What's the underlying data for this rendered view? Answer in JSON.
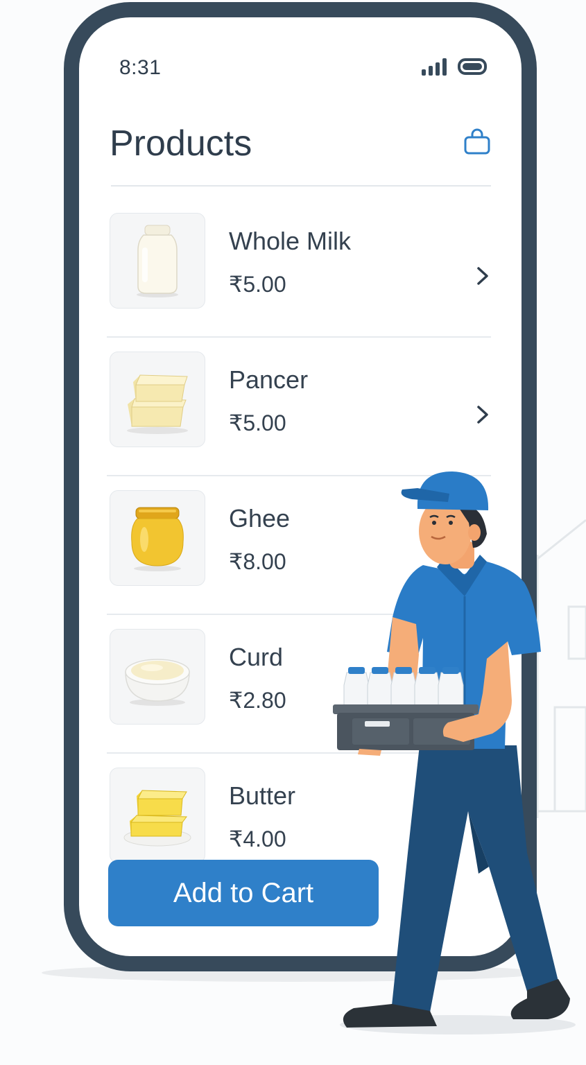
{
  "status_bar": {
    "time": "8:31"
  },
  "header": {
    "title": "Products",
    "cart_icon": "shopping-bag-icon"
  },
  "products": [
    {
      "name": "Whole Milk",
      "price": "₹5.00",
      "image": "milk-jar-icon",
      "has_chevron": true
    },
    {
      "name": "Pancer",
      "price": "₹5.00",
      "image": "paneer-cubes-icon",
      "has_chevron": true
    },
    {
      "name": "Ghee",
      "price": "₹8.00",
      "image": "ghee-jar-icon",
      "has_chevron": false
    },
    {
      "name": "Curd",
      "price": "₹2.80",
      "image": "curd-bowl-icon",
      "has_chevron": false
    },
    {
      "name": "Butter",
      "price": "₹4.00",
      "image": "butter-block-icon",
      "has_chevron": false
    }
  ],
  "footer": {
    "add_to_cart_label": "Add to Cart"
  },
  "colors": {
    "frame": "#374a5b",
    "accent_blue": "#2f80c9",
    "text_dark": "#2f3d4c",
    "uniform_blue": "#2a7cc7",
    "trousers": "#1f4e79"
  }
}
